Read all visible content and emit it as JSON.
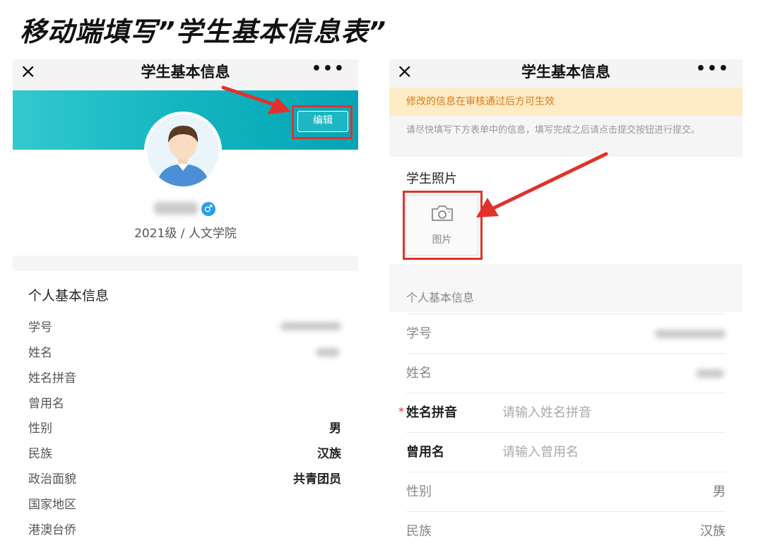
{
  "heading": "移动端填写”学生基本信息表”",
  "left_screen": {
    "title": "学生基本信息",
    "close_icon": "×",
    "more_icon": "•••",
    "edit_button": "编辑",
    "gender_icon": "♂",
    "student_subtitle": "2021级 / 人文学院",
    "section_title": "个人基本信息",
    "fields": [
      {
        "label": "学号",
        "value": ""
      },
      {
        "label": "姓名",
        "value": ""
      },
      {
        "label": "姓名拼音",
        "value": ""
      },
      {
        "label": "曾用名",
        "value": ""
      },
      {
        "label": "性别",
        "value": "男"
      },
      {
        "label": "民族",
        "value": "汉族"
      },
      {
        "label": "政治面貌",
        "value": "共青团员"
      },
      {
        "label": "国家地区",
        "value": ""
      },
      {
        "label": "港澳台侨",
        "value": ""
      }
    ]
  },
  "right_screen": {
    "title": "学生基本信息",
    "close_icon": "×",
    "more_icon": "•••",
    "notice": "修改的信息在审核通过后方可生效",
    "instructions": "请尽快填写下方表单中的信息，填写完成之后请点击提交按钮进行提交。",
    "photo_label": "学生照片",
    "photo_upload_label": "图片",
    "section_title": "个人基本信息",
    "fields": {
      "student_id": {
        "label": "学号"
      },
      "name": {
        "label": "姓名"
      },
      "pinyin": {
        "label": "姓名拼音",
        "placeholder": "请输入姓名拼音",
        "required_mark": "*"
      },
      "former_name": {
        "label": "曾用名",
        "placeholder": "请输入曾用名"
      },
      "gender": {
        "label": "性别",
        "value": "男"
      },
      "ethnicity": {
        "label": "民族",
        "value": "汉族"
      }
    }
  },
  "colors": {
    "accent": "#e0322b",
    "banner": "#12b5c0",
    "notice_bg": "#fdecc5",
    "notice_text": "#d87a1a"
  }
}
